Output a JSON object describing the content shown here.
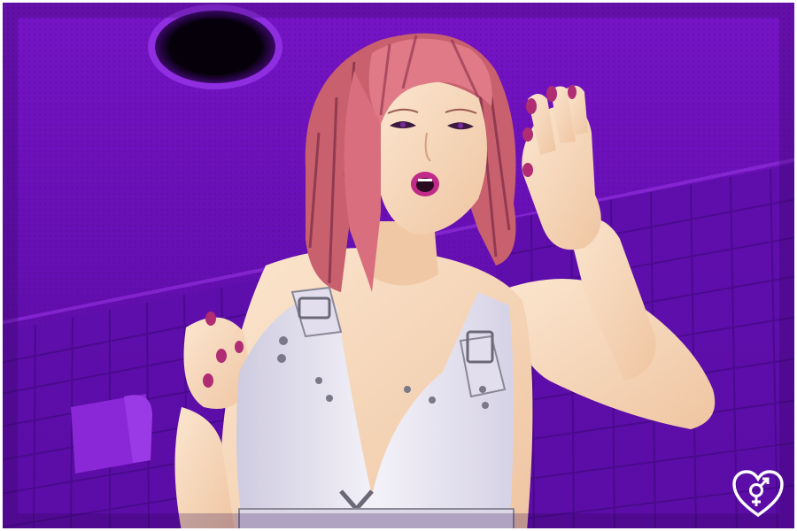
{
  "scene": {
    "type": "visual-novel-cg",
    "setting": "bathroom-ceiling-view",
    "character": {
      "hair_color": "#e07a86",
      "top": "white-strap-tank-top",
      "nail_color": "#b02c73",
      "lip_color": "#c02a88"
    }
  },
  "colors": {
    "background": "#6a0fb8",
    "background_dark": "#3d0877",
    "tile_line": "#4a0a8e",
    "frame": "#ffffff",
    "skin": "#f8dcc0",
    "top": "#e9e6f2"
  },
  "icons": {
    "logo": "heart-gender-symbol-icon",
    "vent": "ceiling-vent-icon"
  }
}
